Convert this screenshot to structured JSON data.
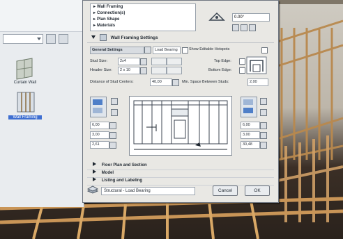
{
  "left_panel": {
    "toolbar": {
      "combo_value": "",
      "label_text": ""
    },
    "thumbnails": [
      {
        "label": "Curtain Wall"
      },
      {
        "label": "Wall Framing"
      }
    ]
  },
  "dialog": {
    "tree": [
      {
        "label": "Wall Framing"
      },
      {
        "label": "Connection(s)"
      },
      {
        "label": "Plan Shape"
      },
      {
        "label": "Materials"
      }
    ],
    "top_right": {
      "value": "0.00°"
    },
    "section_title": "Wall Framing Settings",
    "settings": {
      "general_tab": "General Settings",
      "dropdown_value": "Load Bearing",
      "show_label": "Show Editable Hotspots",
      "stud_size_label": "Stud Size:",
      "stud_size_value": "2x4",
      "header_size_label": "Header Size:",
      "header_size_value": "2 x 10",
      "top_edge_label": "Top Edge:",
      "bottom_edge_label": "Bottom Edge:",
      "distance_label": "Distance of Stud Centers:",
      "distance_value": "40,00",
      "min_space_label": "Min. Space Between Studs:",
      "min_space_value": "2,00"
    },
    "left_fields": [
      "6,00",
      "3,00",
      "2,61"
    ],
    "right_fields": [
      "6,00",
      "3,00",
      "30,48"
    ],
    "collapsed_sections": [
      {
        "label": "Floor Plan and Section"
      },
      {
        "label": "Model"
      },
      {
        "label": "Listing and Labeling"
      }
    ],
    "footer": {
      "layer_value": "Structural - Load Bearing",
      "cancel_label": "Cancel",
      "ok_label": "OK"
    }
  }
}
